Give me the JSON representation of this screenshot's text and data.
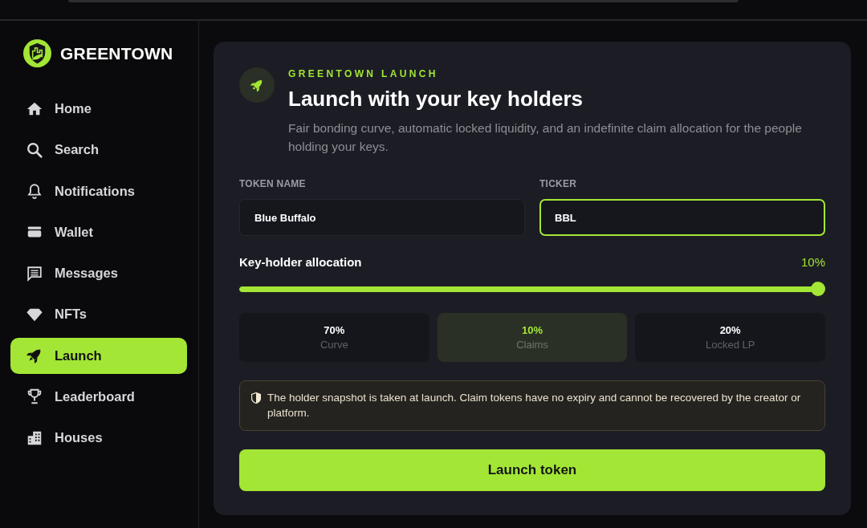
{
  "sidebar": {
    "brand": "GREENTOWN",
    "items": [
      {
        "label": "Home",
        "selected": false
      },
      {
        "label": "Search",
        "selected": false
      },
      {
        "label": "Notifications",
        "selected": false
      },
      {
        "label": "Wallet",
        "selected": false
      },
      {
        "label": "Messages",
        "selected": false
      },
      {
        "label": "NFTs",
        "selected": false
      },
      {
        "label": "Launch",
        "selected": true
      },
      {
        "label": "Leaderboard",
        "selected": false
      },
      {
        "label": "Houses",
        "selected": false
      }
    ]
  },
  "card": {
    "eyebrow": "GREENTOWN LAUNCH",
    "title": "Launch with your key holders",
    "description": "Fair bonding curve, automatic locked liquidity, and an indefinite claim allocation for the people holding your keys.",
    "fields": [
      {
        "label": "TOKEN NAME",
        "value": "Blue Buffalo",
        "focused": false
      },
      {
        "label": "TICKER",
        "value": "BBL",
        "focused": true
      }
    ],
    "allocation": {
      "label": "Key-holder allocation",
      "reading": "10%",
      "level": 1
    },
    "split": [
      {
        "value": "70%",
        "label": "Curve",
        "highlighted": false
      },
      {
        "value": "10%",
        "label": "Claims",
        "highlighted": true
      },
      {
        "value": "20%",
        "label": "Locked LP",
        "highlighted": false
      }
    ],
    "notice": "The holder snapshot is taken at launch. Claim tokens have no expiry and cannot be recovered by the creator or platform.",
    "button": "Launch token"
  }
}
